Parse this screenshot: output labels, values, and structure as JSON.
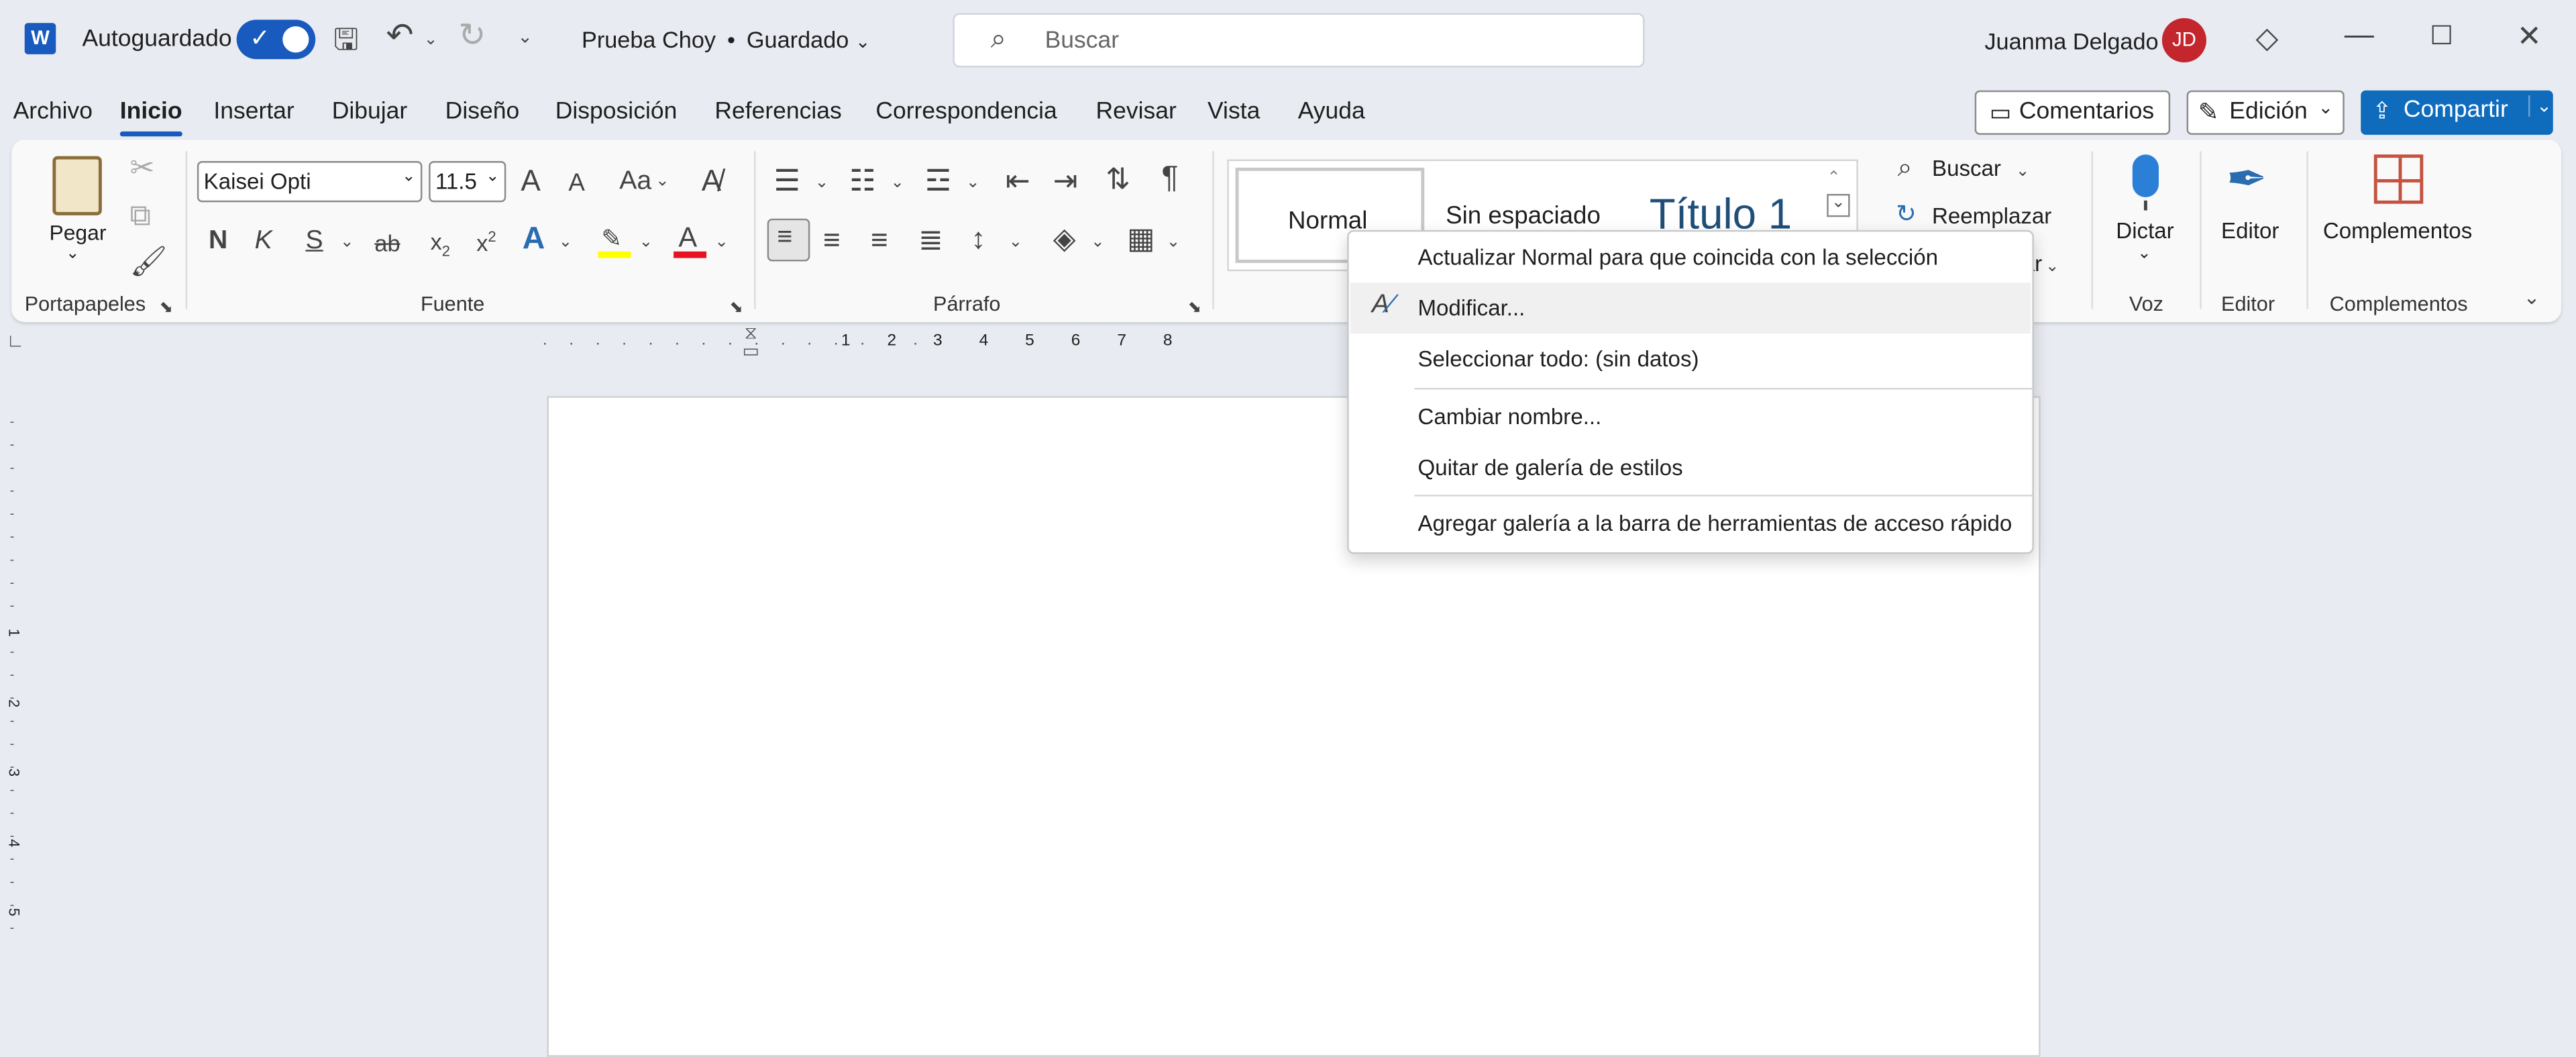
{
  "app": {
    "name": "Word",
    "logo_letter": "W"
  },
  "titlebar": {
    "autosave_label": "Autoguardado",
    "doc_title": "Prueba Choy",
    "doc_status": "Guardado",
    "doc_separator": "•",
    "search_placeholder": "Buscar",
    "user_name": "Juanma Delgado",
    "user_initials": "JD"
  },
  "tabs": [
    "Archivo",
    "Inicio",
    "Insertar",
    "Dibujar",
    "Diseño",
    "Disposición",
    "Referencias",
    "Correspondencia",
    "Revisar",
    "Vista",
    "Ayuda"
  ],
  "active_tab": "Inicio",
  "top_right": {
    "comments": "Comentarios",
    "edit_mode": "Edición",
    "share": "Compartir"
  },
  "ribbon": {
    "clipboard": {
      "paste": "Pegar",
      "label": "Portapapeles"
    },
    "font": {
      "name": "Kaisei Opti",
      "size": "11.5",
      "label": "Fuente",
      "bold": "N",
      "italic": "K",
      "underline": "S",
      "strike": "ab",
      "sub": "x",
      "sub2": "2",
      "sup": "x",
      "sup2": "2",
      "case": "Aa",
      "grow": "A",
      "shrink": "A",
      "color_a": "A",
      "effects_a": "A"
    },
    "paragraph": {
      "label": "Párrafo",
      "pilcrow": "¶"
    },
    "styles": {
      "items": [
        "Normal",
        "Sin espaciado",
        "Título 1"
      ]
    },
    "editing": {
      "find": "Buscar",
      "replace": "Reemplazar",
      "select_partial": "ar"
    },
    "voice": {
      "dictate": "Dictar",
      "label": "Voz"
    },
    "editor": {
      "name": "Editor",
      "label": "Editor"
    },
    "addins": {
      "name": "Complementos",
      "label": "Complementos"
    }
  },
  "context_menu": {
    "items": [
      "Actualizar Normal para que coincida con la selección",
      "Modificar...",
      "Seleccionar todo: (sin datos)",
      "Cambiar nombre...",
      "Quitar de galería de estilos",
      "Agregar galería a la barra de herramientas de acceso rápido"
    ]
  },
  "ruler": {
    "numbers": [
      "1",
      "2",
      "3",
      "4",
      "5",
      "6",
      "7",
      "8"
    ],
    "v_numbers": [
      "1",
      "2",
      "3",
      "4",
      "5"
    ]
  },
  "colors": {
    "accent": "#185abd",
    "share_bg": "#0f6cbd",
    "avatar": "#c4262e",
    "highlight": "#ffff00",
    "font_color": "#e81123"
  }
}
